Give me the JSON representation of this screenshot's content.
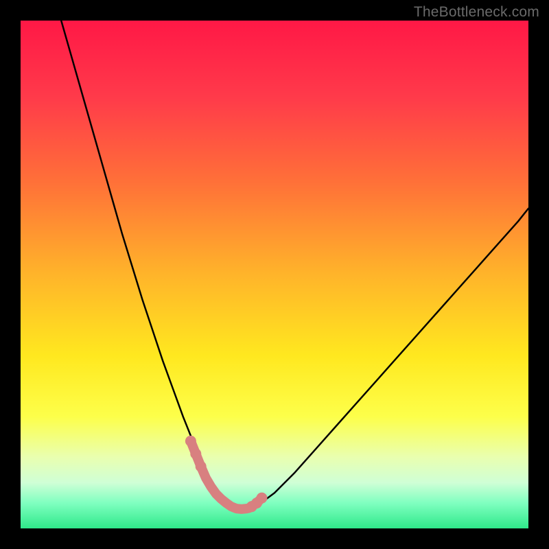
{
  "watermark": "TheBottleneck.com",
  "chart_data": {
    "type": "line",
    "title": "",
    "xlabel": "",
    "ylabel": "",
    "xlim": [
      0,
      100
    ],
    "ylim": [
      0,
      100
    ],
    "series": [
      {
        "name": "bottleneck-curve",
        "x": [
          8,
          10,
          12,
          14,
          16,
          18,
          20,
          22,
          24,
          26,
          28,
          30,
          32,
          33,
          34,
          35,
          36,
          37,
          38,
          39,
          40,
          41,
          42,
          43,
          44,
          46,
          48,
          50,
          54,
          58,
          62,
          66,
          70,
          74,
          78,
          82,
          86,
          90,
          94,
          98,
          100
        ],
        "values": [
          100,
          93,
          86,
          79,
          72,
          65,
          58,
          51.5,
          45,
          39,
          33,
          27.5,
          22,
          19.5,
          17,
          14.5,
          12,
          10,
          8.5,
          7,
          6,
          5,
          4.2,
          3.8,
          3.8,
          4.3,
          5.5,
          7,
          11,
          15.5,
          20,
          24.5,
          29,
          33.5,
          38,
          42.5,
          47,
          51.5,
          56,
          60.5,
          63
        ]
      },
      {
        "name": "highlight-curve",
        "x": [
          33.5,
          34.5,
          35.5,
          36.5,
          37.5,
          38.5,
          39.5,
          40.5,
          41.5,
          42.5,
          43.5,
          44.5,
          45.0,
          45.5,
          46.5,
          47.5
        ],
        "values": [
          17.2,
          14.7,
          12.2,
          9.9,
          8.2,
          6.8,
          5.8,
          5.0,
          4.3,
          3.9,
          3.8,
          3.9,
          4.0,
          4.3,
          5.0,
          6.0
        ]
      }
    ],
    "gradient_stops": [
      {
        "offset": 0.0,
        "color": "#ff1846"
      },
      {
        "offset": 0.15,
        "color": "#ff3a4a"
      },
      {
        "offset": 0.32,
        "color": "#ff7138"
      },
      {
        "offset": 0.5,
        "color": "#ffb42a"
      },
      {
        "offset": 0.66,
        "color": "#ffe81f"
      },
      {
        "offset": 0.78,
        "color": "#fdff4a"
      },
      {
        "offset": 0.86,
        "color": "#e9ffb0"
      },
      {
        "offset": 0.91,
        "color": "#cfffd6"
      },
      {
        "offset": 0.95,
        "color": "#7fffc0"
      },
      {
        "offset": 1.0,
        "color": "#2fe98a"
      }
    ]
  }
}
